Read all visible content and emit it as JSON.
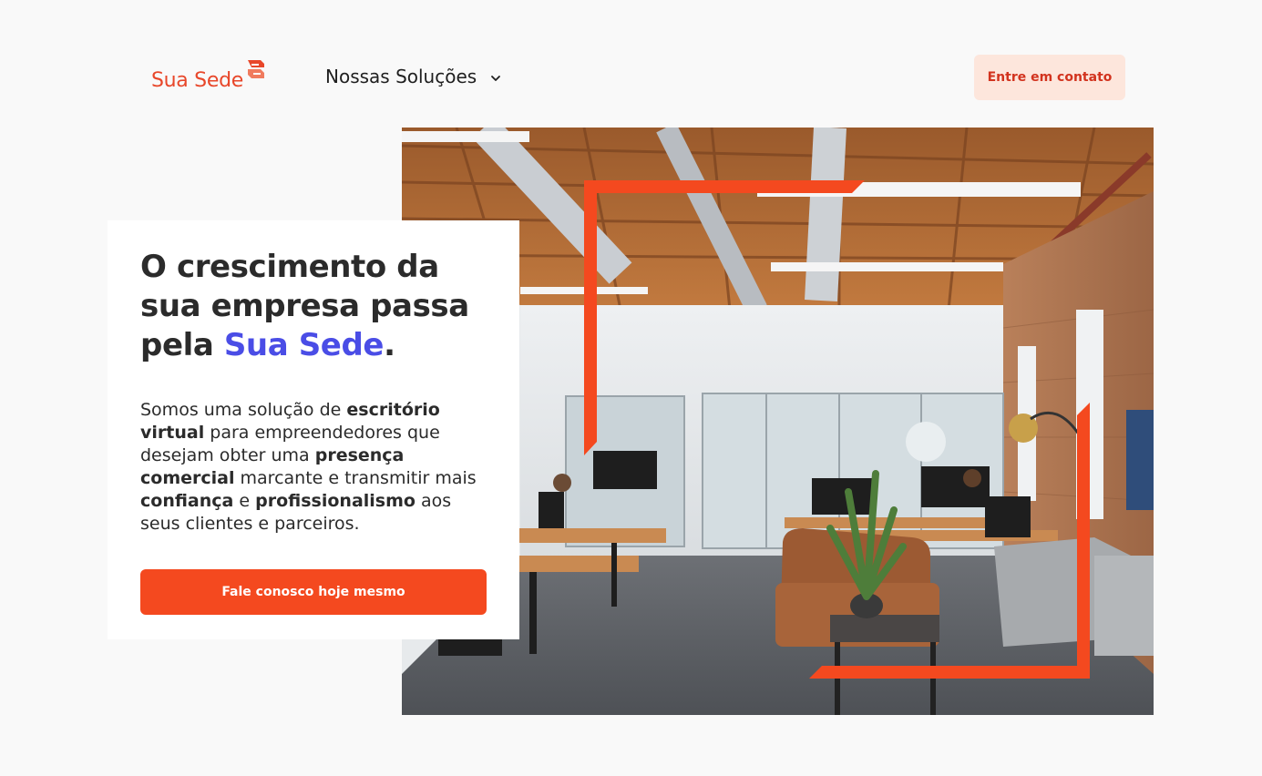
{
  "header": {
    "logo_text": "Sua Sede",
    "nav_item": "Nossas Soluções",
    "contact_button": "Entre em contato"
  },
  "hero": {
    "headline_part1": "O crescimento da sua empresa passa pela",
    "headline_brand": "Sua Sede",
    "headline_end": ".",
    "desc": {
      "t1": "Somos uma solução de ",
      "b1": "escritório virtual",
      "t2": " para empreendedores que desejam obter uma ",
      "b2": "presença comercial",
      "t3": " marcante e transmitir mais ",
      "b3": "confiança",
      "t4": " e ",
      "b4": "profissionalismo",
      "t5": " aos seus clientes e parceiros."
    },
    "cta": "Fale conosco hoje mesmo"
  },
  "icons": {
    "logo_mark": "sua-sede-logo-icon",
    "chevron": "chevron-down-icon"
  },
  "colors": {
    "brand_orange": "#f4491f",
    "brand_blue": "#4a4de6",
    "soft_orange": "#fde6dc",
    "background": "#f9f9f9"
  }
}
